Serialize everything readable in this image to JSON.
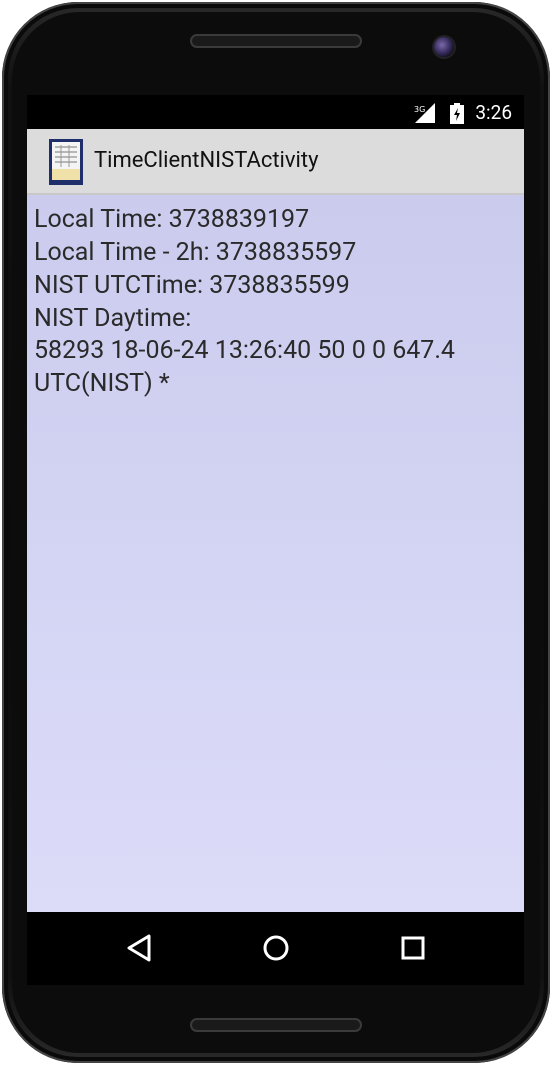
{
  "status_bar": {
    "network": "3G",
    "time": "3:26"
  },
  "action_bar": {
    "title": "TimeClientNISTActivity",
    "icon": "app-icon"
  },
  "content": {
    "lines": [
      "Local Time: 3738839197",
      "Local Time - 2h: 3738835597",
      "NIST UTCTime: 3738835599",
      "NIST Daytime:",
      "58293 18-06-24 13:26:40 50 0 0 647.4",
      "UTC(NIST) *"
    ]
  },
  "nav_bar": {
    "back_icon": "back-triangle-icon",
    "home_icon": "home-circle-icon",
    "recent_icon": "recent-apps-square-icon"
  },
  "colors": {
    "action_bar_bg": "#dcdcdc",
    "content_bg_top": "#cbcbee",
    "content_bg_bottom": "#dcdcf9",
    "text": "#2a2a2a"
  }
}
